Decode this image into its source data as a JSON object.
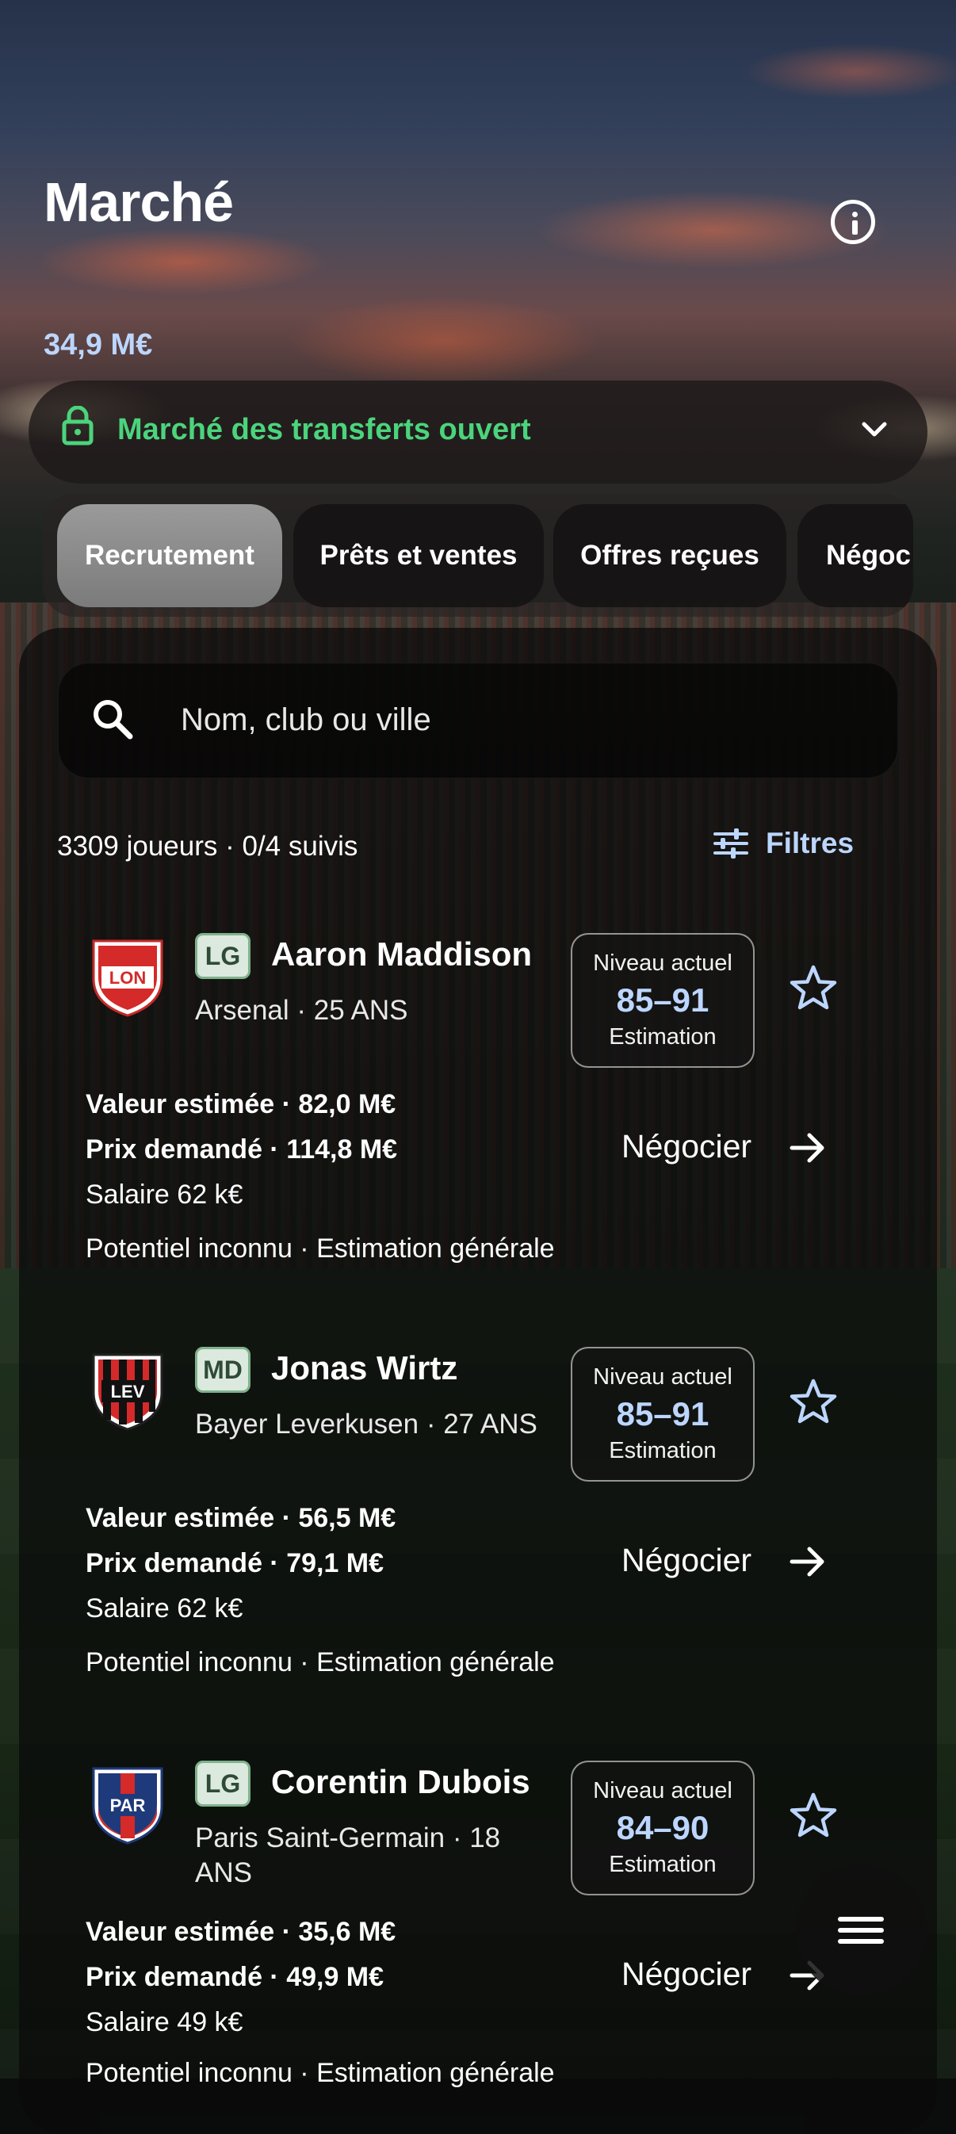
{
  "header": {
    "title": "Marché",
    "budget": "34,9 M€",
    "info_icon": "info-circle-icon"
  },
  "market_status": {
    "label": "Marché des transferts ouvert",
    "color": "#4bd47c",
    "icon": "lock-open-icon"
  },
  "tabs": [
    {
      "label": "Recrutement",
      "active": true
    },
    {
      "label": "Prêts et ventes",
      "active": false
    },
    {
      "label": "Offres reçues",
      "active": false
    },
    {
      "label": "Négoc",
      "active": false
    }
  ],
  "search": {
    "placeholder": "Nom, club ou ville"
  },
  "summary": {
    "count_text": "3309 joueurs · 0/4 suivis",
    "filters_label": "Filtres"
  },
  "players": [
    {
      "crest": "LON",
      "position": "LG",
      "name": "Aaron Maddison",
      "club_age": "Arsenal · 25 ANS",
      "level_title": "Niveau actuel",
      "level_range": "85–91",
      "level_note": "Estimation",
      "value": "Valeur estimée · 82,0 M€",
      "price": "Prix demandé · 114,8 M€",
      "salary": "Salaire 62 k€",
      "potential": "Potentiel inconnu · Estimation générale",
      "action": "Négocier"
    },
    {
      "crest": "LEV",
      "position": "MD",
      "name": "Jonas Wirtz",
      "club_age": "Bayer Leverkusen · 27 ANS",
      "level_title": "Niveau actuel",
      "level_range": "85–91",
      "level_note": "Estimation",
      "value": "Valeur estimée · 56,5 M€",
      "price": "Prix demandé · 79,1 M€",
      "salary": "Salaire 62 k€",
      "potential": "Potentiel inconnu · Estimation générale",
      "action": "Négocier"
    },
    {
      "crest": "PAR",
      "position": "LG",
      "name": "Corentin Dubois",
      "club_age": "Paris Saint-Germain · 18 ANS",
      "level_title": "Niveau actuel",
      "level_range": "84–90",
      "level_note": "Estimation",
      "value": "Valeur estimée · 35,6 M€",
      "price": "Prix demandé · 49,9 M€",
      "salary": "Salaire 49 k€",
      "potential": "Potentiel inconnu · Estimation générale",
      "action": "Négocier"
    }
  ],
  "menu_icon": "hamburger-menu-icon"
}
